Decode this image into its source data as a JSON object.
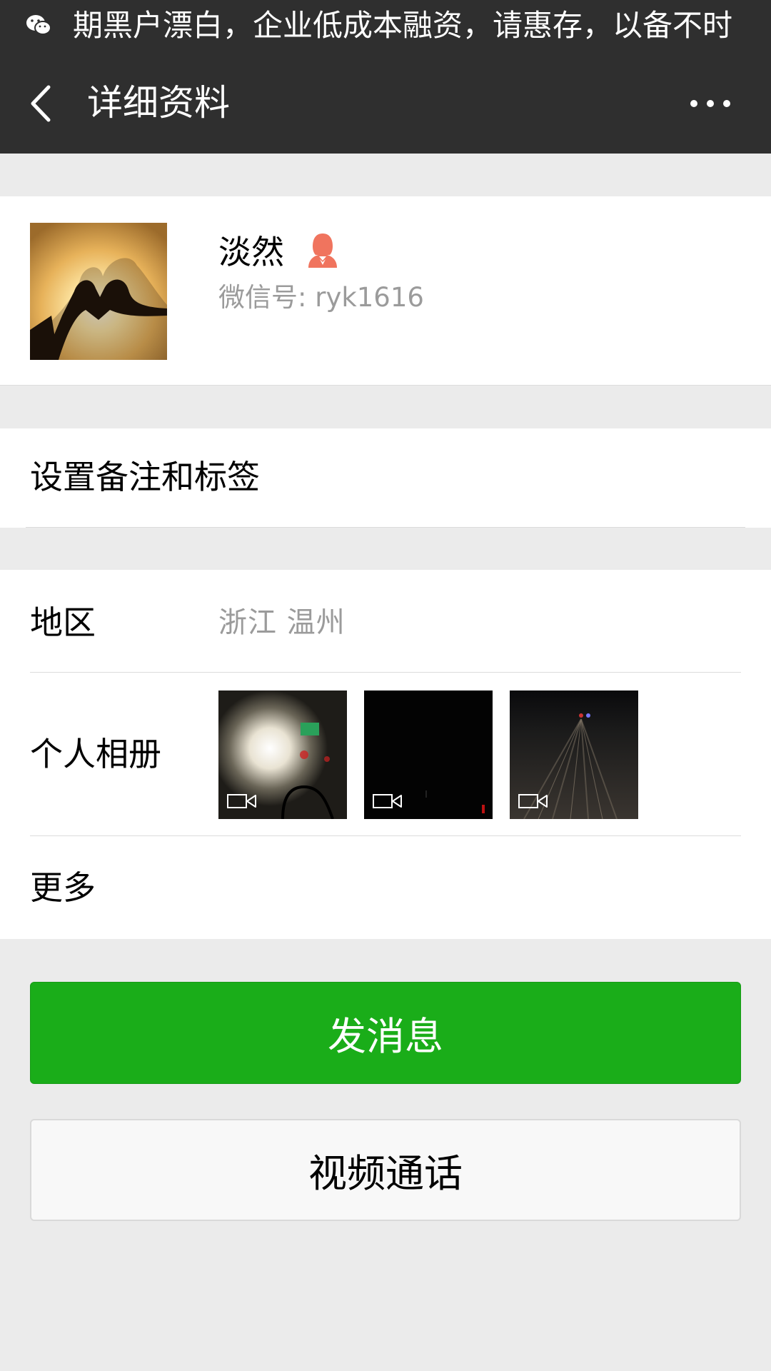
{
  "ticker": {
    "icon": "wechat-icon",
    "text": "期黑户漂白，企业低成本融资，请惠存，以备不时"
  },
  "navbar": {
    "back_icon": "chevron-left-icon",
    "title": "详细资料",
    "more_icon": "more-horizontal-icon"
  },
  "profile": {
    "name": "淡然",
    "gender_icon": "female-user-icon",
    "wechat_id": "微信号: ryk1616"
  },
  "remark": {
    "label": "设置备注和标签"
  },
  "info": {
    "region_label": "地区",
    "region_value": "浙江  温州",
    "album_label": "个人相册",
    "album_items": [
      {
        "type": "video",
        "icon": "video-camera-icon"
      },
      {
        "type": "video",
        "icon": "video-camera-icon"
      },
      {
        "type": "video",
        "icon": "video-camera-icon"
      }
    ],
    "more_label": "更多"
  },
  "actions": {
    "send_message": "发消息",
    "video_call": "视频通话"
  },
  "colors": {
    "header_bg": "#2f2f2f",
    "page_bg": "#ebebeb",
    "primary_green": "#1aad19",
    "secondary_text": "#9b9b9b",
    "gender_female": "#f0745e"
  }
}
